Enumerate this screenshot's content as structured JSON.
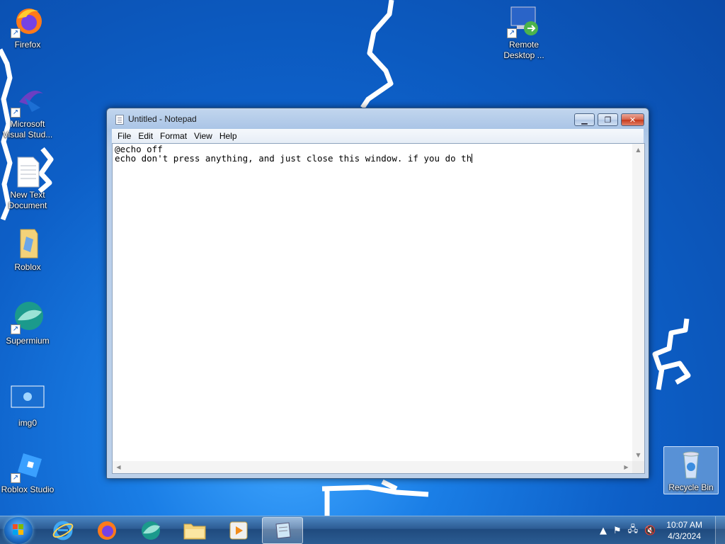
{
  "desktop": {
    "icons": [
      {
        "label": "Firefox"
      },
      {
        "label": "Microsoft\nVisual Stud..."
      },
      {
        "label": "New Text\nDocument"
      },
      {
        "label": "Roblox"
      },
      {
        "label": "Supermium"
      },
      {
        "label": "img0"
      },
      {
        "label": "Roblox Studio"
      },
      {
        "label": "Remote\nDesktop ..."
      },
      {
        "label": "Recycle Bin"
      }
    ]
  },
  "notepad": {
    "title": "Untitled - Notepad",
    "menu": [
      "File",
      "Edit",
      "Format",
      "View",
      "Help"
    ],
    "content_line1": "@echo off",
    "content_line2": "echo don't press anything, and just close this window. if you do th"
  },
  "taskbar": {
    "time": "10:07 AM",
    "date": "4/3/2024"
  },
  "colors": {
    "desktop_blue": "#0d5fc7",
    "taskbar_blue": "#2c5b93",
    "close_red": "#c6391a"
  }
}
